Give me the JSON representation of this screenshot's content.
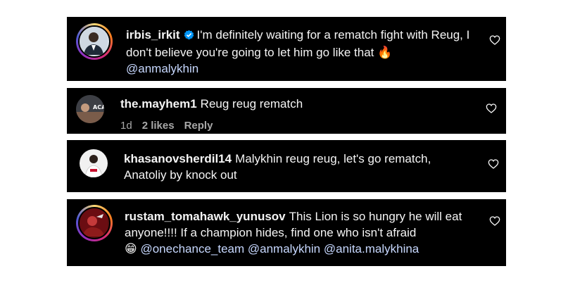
{
  "comments": [
    {
      "username": "irbis_irkit",
      "verified": true,
      "text": "I'm definitely waiting for a rematch fight with Reug, I don't believe you're going to let him go like that",
      "emoji": "🔥",
      "mentions": [
        "@anmalykhin"
      ]
    },
    {
      "username": "the.mayhem1",
      "text": "Reug reug rematch",
      "meta": {
        "age": "1d",
        "likes": "2 likes",
        "reply": "Reply"
      }
    },
    {
      "username": "khasanovsherdil14",
      "text": "Malykhin reug reug, let's go rematch, Anatoliy by knock out"
    },
    {
      "username": "rustam_tomahawk_yunusov",
      "text": "This Lion is so hungry he will eat anyone!!!! If a champion hides, find one who isn't afraid",
      "emoji": "😁",
      "mentions": [
        "@onechance_team",
        "@anmalykhin",
        "@anita.malykhina"
      ]
    }
  ],
  "icons": {
    "like": "heart-outline-icon",
    "verified": "verified-badge-icon"
  },
  "colors": {
    "card_bg": "#000000",
    "text": "#f5f5f5",
    "muted": "#a8a8a8",
    "mention": "#c7d8ff",
    "verified": "#0095f6"
  }
}
